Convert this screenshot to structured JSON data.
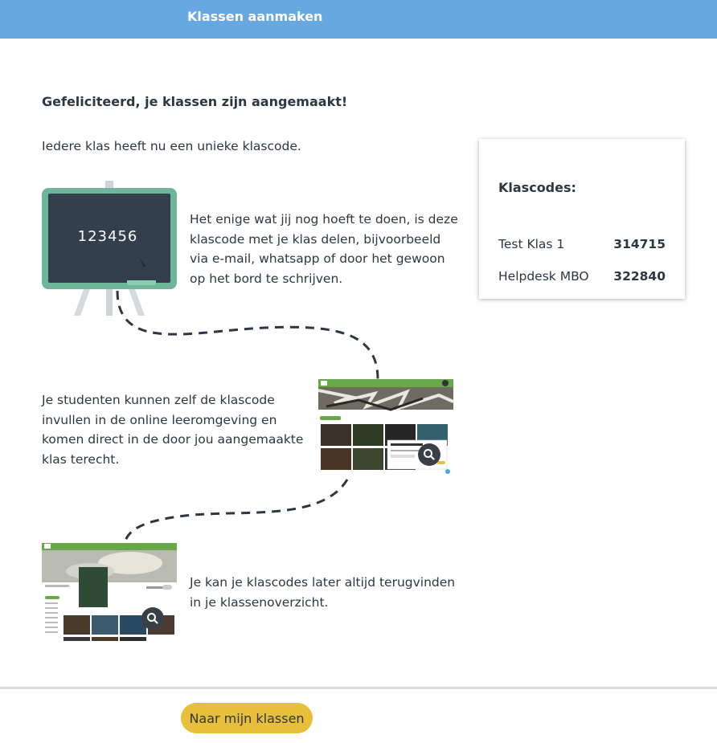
{
  "header": {
    "title": "Klassen aanmaken"
  },
  "content": {
    "congrats": "Gefeliciteerd, je klassen zijn aangemaakt!",
    "intro": "Iedere klas heeft nu een unieke klascode.",
    "board_code": "123456",
    "paragraph1": "Het enige wat jij nog hoeft te doen, is deze klascode met je klas delen, bijvoorbeeld via e-mail, whatsapp of door het gewoon op het bord te schrijven.",
    "paragraph2": "Je studenten kunnen zelf de klascode invullen in de online leeromgeving en komen direct in de door jou aangemaakte klas terecht.",
    "paragraph3": "Je kan je klascodes later altijd terugvinden in je klassenoverzicht."
  },
  "codes_card": {
    "heading": "Klascodes:",
    "rows": [
      {
        "name": "Test Klas 1",
        "code": "314715"
      },
      {
        "name": "Helpdesk MBO",
        "code": "322840"
      }
    ]
  },
  "footer": {
    "button_label": "Naar mijn klassen"
  },
  "colors": {
    "header": "#67a7e2",
    "button": "#e8bf3a",
    "board_frame": "#6eb59b",
    "board_surface": "#343f4c"
  },
  "icons": [
    "magnifier-icon",
    "chalkboard-illustration"
  ]
}
